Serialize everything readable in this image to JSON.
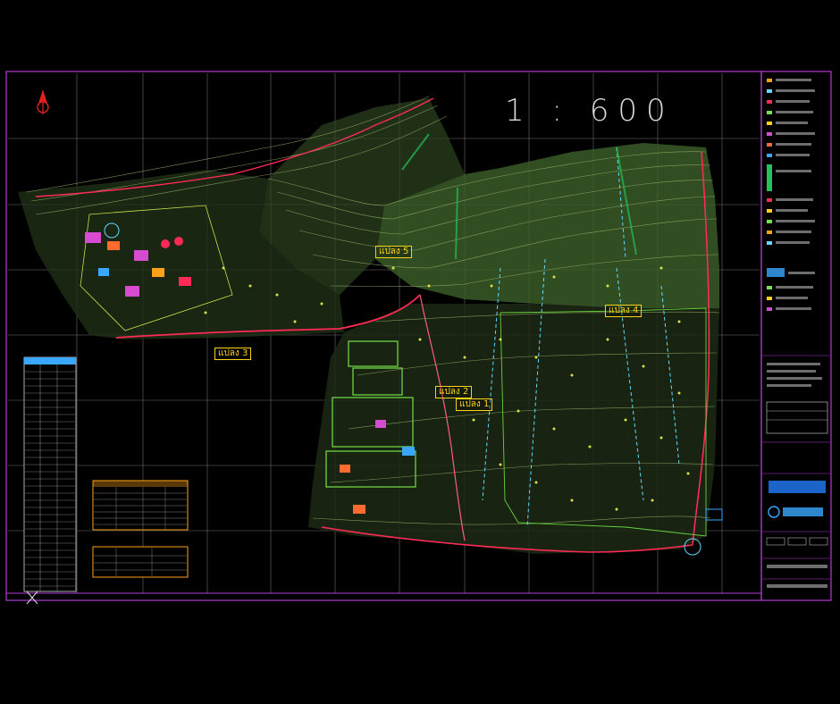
{
  "drawing": {
    "scale_text": "1 : 600",
    "zone_labels": [
      "แปลง 3",
      "แปลง 4",
      "แปลง 2",
      "แปลง 1",
      "แปลง 5"
    ]
  },
  "colors": {
    "background": "#000000",
    "frame": "#b03cd0",
    "grid": "#8c8c8c",
    "contour": "#9bb56a",
    "vegetation": "#3f5e2c",
    "road": "#ff2a55",
    "utility": "#62d9ff",
    "parcel": "#74e24a",
    "label": "#ffd21a",
    "north_arrow": "#e0221d"
  },
  "icons": {
    "north_arrow": "north-arrow-icon"
  }
}
